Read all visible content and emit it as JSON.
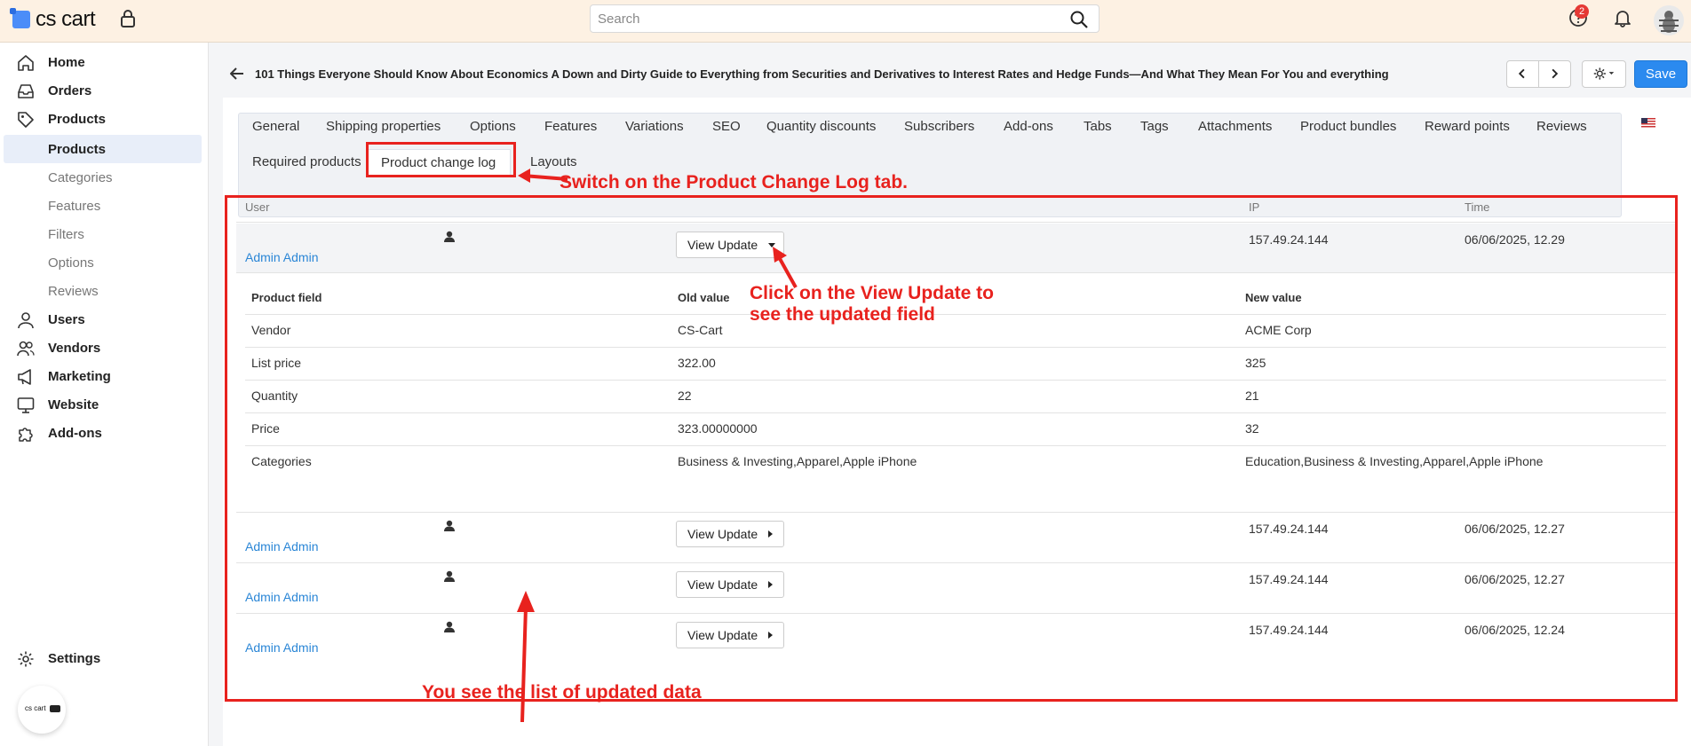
{
  "topbar": {
    "logo_text": "cs cart",
    "search_placeholder": "Search",
    "help_badge_count": "2"
  },
  "sidebar": {
    "items": [
      {
        "label": "Home",
        "icon": "home-icon"
      },
      {
        "label": "Orders",
        "icon": "inbox-icon"
      },
      {
        "label": "Products",
        "icon": "tag-icon"
      },
      {
        "label": "Users",
        "icon": "user-icon"
      },
      {
        "label": "Vendors",
        "icon": "users-icon"
      },
      {
        "label": "Marketing",
        "icon": "megaphone-icon"
      },
      {
        "label": "Website",
        "icon": "monitor-icon"
      },
      {
        "label": "Add-ons",
        "icon": "puzzle-icon"
      },
      {
        "label": "Settings",
        "icon": "gear-icon"
      }
    ],
    "product_subitems": [
      "Products",
      "Categories",
      "Features",
      "Filters",
      "Options",
      "Reviews"
    ],
    "active_subitem": "Products",
    "mini_logo_text": "cs cart"
  },
  "page": {
    "title": "101 Things Everyone Should Know About Economics A Down and Dirty Guide to Everything from Securities and Derivatives to Interest Rates and Hedge Funds—And What They Mean For You and everything",
    "save_label": "Save"
  },
  "tabs": {
    "row1": [
      "General",
      "Shipping properties",
      "Options",
      "Features",
      "Variations",
      "SEO",
      "Quantity discounts",
      "Subscribers",
      "Add-ons",
      "Tabs",
      "Tags",
      "Attachments",
      "Product bundles",
      "Reward points",
      "Reviews"
    ],
    "row2": [
      "Required products",
      "Product change log",
      "Layouts"
    ],
    "active": "Product change log"
  },
  "log_table": {
    "headers": {
      "user": "User",
      "ip": "IP",
      "time": "Time"
    },
    "view_update_label": "View Update",
    "rows": [
      {
        "user": "Admin Admin",
        "ip": "157.49.24.144",
        "time": "06/06/2025, 12.29",
        "expanded": true
      },
      {
        "user": "Admin Admin",
        "ip": "157.49.24.144",
        "time": "06/06/2025, 12.27",
        "expanded": false
      },
      {
        "user": "Admin Admin",
        "ip": "157.49.24.144",
        "time": "06/06/2025, 12.27",
        "expanded": false
      },
      {
        "user": "Admin Admin",
        "ip": "157.49.24.144",
        "time": "06/06/2025, 12.24",
        "expanded": false
      }
    ],
    "detail_headers": {
      "field": "Product field",
      "old": "Old value",
      "new": "New value"
    },
    "details": [
      {
        "field": "Vendor",
        "old": "CS-Cart",
        "new": "ACME Corp"
      },
      {
        "field": "List price",
        "old": "322.00",
        "new": "325"
      },
      {
        "field": "Quantity",
        "old": "22",
        "new": "21"
      },
      {
        "field": "Price",
        "old": "323.00000000",
        "new": "32"
      },
      {
        "field": "Categories",
        "old": "Business & Investing,Apparel,Apple iPhone",
        "new": "Education,Business & Investing,Apparel,Apple iPhone"
      }
    ]
  },
  "annotations": {
    "switch_tab": "Switch on the Product Change Log tab.",
    "click_view_line1": "Click on the View Update to",
    "click_view_line2": "see the updated field",
    "list_note": "You see the list of updated data",
    "color": "#e8221e"
  }
}
